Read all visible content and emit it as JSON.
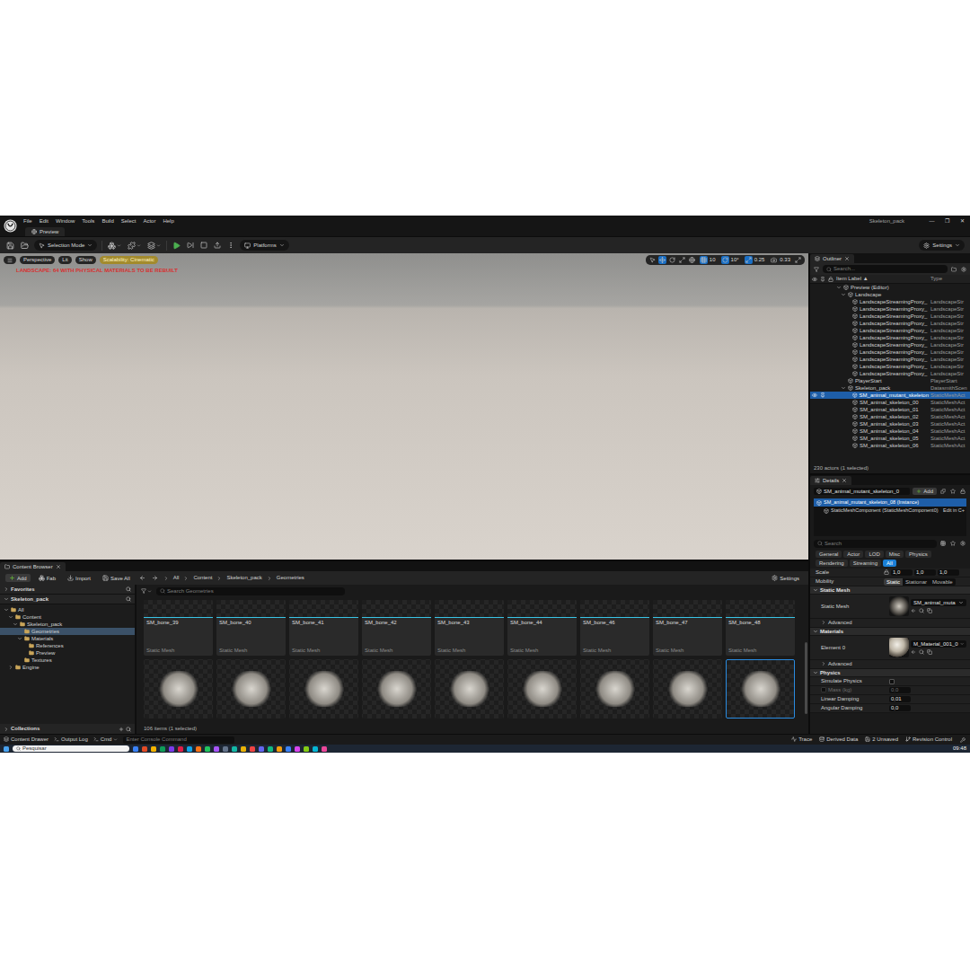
{
  "window": {
    "title": "Skeleton_pack",
    "menu": [
      "File",
      "Edit",
      "Window",
      "Tools",
      "Build",
      "Select",
      "Actor",
      "Help"
    ],
    "controls": [
      "—",
      "❐",
      "✕"
    ]
  },
  "level_tab": {
    "label": "Preview"
  },
  "toolbar": {
    "mode": "Selection Mode",
    "platforms": "Platforms",
    "settings": "Settings"
  },
  "viewport": {
    "view_buttons": [
      "Perspective",
      "Lit",
      "Show"
    ],
    "scalability": "Scalability: Cinematic",
    "transform_tools": [
      {
        "selected": false
      },
      {
        "selected": true
      },
      {
        "selected": false
      },
      {
        "selected": false
      }
    ],
    "snaps": [
      {
        "value": "10",
        "active": true
      },
      {
        "value": "10°",
        "active": true
      },
      {
        "value": "0.25",
        "active": true
      },
      {
        "value": "0.33",
        "active": false
      }
    ],
    "warning": "LANDSCAPE: 64 WITH PHYSICAL MATERIALS TO BE REBUILT"
  },
  "content_browser": {
    "tab": "Content Browser",
    "actions": [
      "Add",
      "Fab",
      "Import",
      "Save All"
    ],
    "breadcrumbs": [
      "All",
      "Content",
      "Skeleton_pack",
      "Geometries"
    ],
    "settings": "Settings",
    "favorites": "Favorites",
    "root": "Skeleton_pack",
    "tree": [
      {
        "label": "All",
        "depth": 0,
        "kind": "open",
        "selected": false
      },
      {
        "label": "Content",
        "depth": 1,
        "kind": "open",
        "selected": false
      },
      {
        "label": "Skeleton_pack",
        "depth": 2,
        "kind": "open",
        "selected": false
      },
      {
        "label": "Geometries",
        "depth": 3,
        "kind": "leaf",
        "selected": true
      },
      {
        "label": "Materials",
        "depth": 3,
        "kind": "open",
        "selected": false
      },
      {
        "label": "References",
        "depth": 4,
        "kind": "leaf",
        "selected": false
      },
      {
        "label": "Preview",
        "depth": 4,
        "kind": "leaf",
        "selected": false
      },
      {
        "label": "Textures",
        "depth": 3,
        "kind": "leaf",
        "selected": false
      },
      {
        "label": "Engine",
        "depth": 1,
        "kind": "closed",
        "selected": false
      }
    ],
    "collections": "Collections",
    "search": "Search Geometries",
    "assets": [
      {
        "name": "SM_bone_39",
        "type": "Static Mesh"
      },
      {
        "name": "SM_bone_40",
        "type": "Static Mesh"
      },
      {
        "name": "SM_bone_41",
        "type": "Static Mesh"
      },
      {
        "name": "SM_bone_42",
        "type": "Static Mesh"
      },
      {
        "name": "SM_bone_43",
        "type": "Static Mesh"
      },
      {
        "name": "SM_bone_44",
        "type": "Static Mesh"
      },
      {
        "name": "SM_bone_46",
        "type": "Static Mesh"
      },
      {
        "name": "SM_bone_47",
        "type": "Static Mesh"
      },
      {
        "name": "SM_bone_48",
        "type": "Static Mesh"
      }
    ],
    "thumbnails": [
      {
        "selected": false
      },
      {
        "selected": false
      },
      {
        "selected": false
      },
      {
        "selected": false
      },
      {
        "selected": false
      },
      {
        "selected": false
      },
      {
        "selected": false
      },
      {
        "selected": false
      },
      {
        "selected": true
      }
    ],
    "count": "106 items (1 selected)"
  },
  "outliner": {
    "title": "Outliner",
    "search": "Search...",
    "columns": [
      "Item Label ▲",
      "Type"
    ],
    "rows": [
      {
        "label": "Preview (Editor)",
        "type": "",
        "depth": 0,
        "kind": "open",
        "selected": false
      },
      {
        "label": "Landscape",
        "type": "",
        "depth": 1,
        "kind": "open",
        "selected": false
      },
      {
        "label": "LandscapeStreamingProxy_",
        "type": "LandscapeStr",
        "depth": 2,
        "kind": "leaf",
        "selected": false
      },
      {
        "label": "LandscapeStreamingProxy_",
        "type": "LandscapeStr",
        "depth": 2,
        "kind": "leaf",
        "selected": false
      },
      {
        "label": "LandscapeStreamingProxy_",
        "type": "LandscapeStr",
        "depth": 2,
        "kind": "leaf",
        "selected": false
      },
      {
        "label": "LandscapeStreamingProxy_",
        "type": "LandscapeStr",
        "depth": 2,
        "kind": "leaf",
        "selected": false
      },
      {
        "label": "LandscapeStreamingProxy_",
        "type": "LandscapeStr",
        "depth": 2,
        "kind": "leaf",
        "selected": false
      },
      {
        "label": "LandscapeStreamingProxy_",
        "type": "LandscapeStr",
        "depth": 2,
        "kind": "leaf",
        "selected": false
      },
      {
        "label": "LandscapeStreamingProxy_",
        "type": "LandscapeStr",
        "depth": 2,
        "kind": "leaf",
        "selected": false
      },
      {
        "label": "LandscapeStreamingProxy_",
        "type": "LandscapeStr",
        "depth": 2,
        "kind": "leaf",
        "selected": false
      },
      {
        "label": "LandscapeStreamingProxy_",
        "type": "LandscapeStr",
        "depth": 2,
        "kind": "leaf",
        "selected": false
      },
      {
        "label": "LandscapeStreamingProxy_",
        "type": "LandscapeStr",
        "depth": 2,
        "kind": "leaf",
        "selected": false
      },
      {
        "label": "LandscapeStreamingProxy_",
        "type": "LandscapeStr",
        "depth": 2,
        "kind": "leaf",
        "selected": false
      },
      {
        "label": "PlayerStart",
        "type": "PlayerStart",
        "depth": 1,
        "kind": "leaf",
        "selected": false
      },
      {
        "label": "Skeleton_pack",
        "type": "DatasmithScen",
        "depth": 1,
        "kind": "open",
        "selected": false
      },
      {
        "label": "SM_animal_mutant_skeleton",
        "type": "StaticMeshAct",
        "depth": 2,
        "kind": "leaf",
        "selected": true
      },
      {
        "label": "SM_animal_skeleton_00",
        "type": "StaticMeshAct",
        "depth": 2,
        "kind": "leaf",
        "selected": false
      },
      {
        "label": "SM_animal_skeleton_01",
        "type": "StaticMeshAct",
        "depth": 2,
        "kind": "leaf",
        "selected": false
      },
      {
        "label": "SM_animal_skeleton_02",
        "type": "StaticMeshAct",
        "depth": 2,
        "kind": "leaf",
        "selected": false
      },
      {
        "label": "SM_animal_skeleton_03",
        "type": "StaticMeshAct",
        "depth": 2,
        "kind": "leaf",
        "selected": false
      },
      {
        "label": "SM_animal_skeleton_04",
        "type": "StaticMeshAct",
        "depth": 2,
        "kind": "leaf",
        "selected": false
      },
      {
        "label": "SM_animal_skeleton_05",
        "type": "StaticMeshAct",
        "depth": 2,
        "kind": "leaf",
        "selected": false
      },
      {
        "label": "SM_animal_skeleton_06",
        "type": "StaticMeshAct",
        "depth": 2,
        "kind": "leaf",
        "selected": false
      }
    ],
    "footer": "230 actors (1 selected)"
  },
  "details": {
    "title": "Details",
    "actor": "SM_animal_mutant_skeleton_0",
    "add": "Add",
    "components": [
      {
        "label": "SM_animal_mutant_skeleton_08 (Instance)",
        "depth": 0,
        "selected": true,
        "action": ""
      },
      {
        "label": "StaticMeshComponent (StaticMeshComponent0)",
        "depth": 1,
        "selected": false,
        "action": "Edit in C+"
      }
    ],
    "search": "Search",
    "filters": [
      {
        "label": "General",
        "selected": false
      },
      {
        "label": "Actor",
        "selected": false
      },
      {
        "label": "LOD",
        "selected": false
      },
      {
        "label": "Misc",
        "selected": false
      },
      {
        "label": "Physics",
        "selected": false
      },
      {
        "label": "Rendering",
        "selected": false
      },
      {
        "label": "Streaming",
        "selected": false
      },
      {
        "label": "All",
        "selected": true
      }
    ],
    "scale": {
      "label": "Scale",
      "values": [
        "1,0",
        "1,0",
        "1,0"
      ]
    },
    "mobility": {
      "label": "Mobility",
      "options": [
        {
          "label": "Static",
          "selected": true
        },
        {
          "label": "Stationar",
          "selected": false
        },
        {
          "label": "Movable",
          "selected": false
        }
      ]
    },
    "sections": [
      {
        "title": "Static Mesh",
        "rows": [
          {
            "kind": "asset",
            "label": "Static Mesh",
            "value": "SM_animal_muta"
          },
          {
            "kind": "advanced",
            "label": "Advanced"
          }
        ]
      },
      {
        "title": "Materials",
        "rows": [
          {
            "kind": "material",
            "label": "Element 0",
            "value": "M_Material_001_0"
          },
          {
            "kind": "advanced",
            "label": "Advanced"
          }
        ]
      },
      {
        "title": "Physics",
        "rows": [
          {
            "kind": "checkbox",
            "label": "Simulate Physics",
            "checked": false,
            "disabled": false
          },
          {
            "kind": "override",
            "label": "Mass (kg)",
            "value": "0,0",
            "checked": false,
            "disabled": true
          },
          {
            "kind": "number",
            "label": "Linear Damping",
            "value": "0,01",
            "disabled": false
          },
          {
            "kind": "number",
            "label": "Angular Damping",
            "value": "0,0",
            "disabled": false
          }
        ]
      }
    ]
  },
  "status_bar": {
    "items": [
      "Content Drawer",
      "Output Log"
    ],
    "cmd": "Cmd",
    "console": "Enter Console Command",
    "right": [
      "Trace",
      "Derived Data",
      "2 Unsaved",
      "Revision Control"
    ]
  },
  "taskbar": {
    "search": "Pesquisar",
    "time": "09:48"
  }
}
